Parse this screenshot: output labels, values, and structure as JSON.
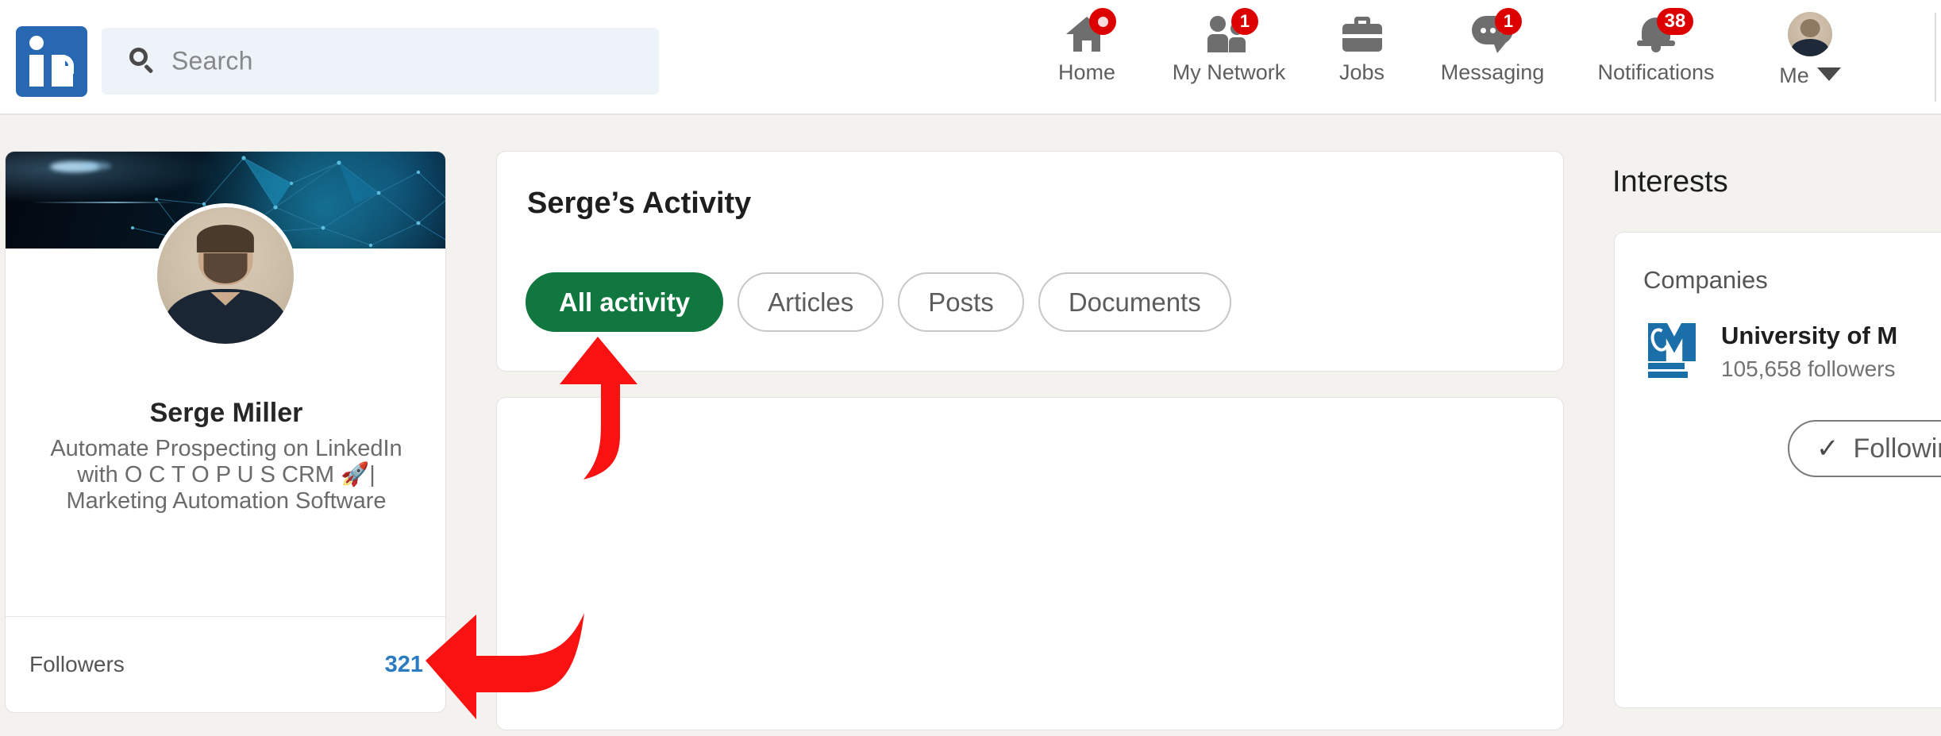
{
  "nav": {
    "logo_alt": "linkedin-logo",
    "search": {
      "placeholder": "Search",
      "value": ""
    },
    "items": [
      {
        "label": "Home",
        "icon": "home-icon",
        "badge": ""
      },
      {
        "label": "My Network",
        "icon": "network-icon",
        "badge": "1"
      },
      {
        "label": "Jobs",
        "icon": "briefcase-icon",
        "badge": ""
      },
      {
        "label": "Messaging",
        "icon": "message-icon",
        "badge": "1"
      },
      {
        "label": "Notifications",
        "icon": "bell-icon",
        "badge": "38"
      }
    ],
    "me": {
      "label": "Me",
      "caret": "chevron-down-icon"
    }
  },
  "profile": {
    "name": "Serge Miller",
    "headline": "Automate Prospecting on LinkedIn with O C T O P U S CRM 🚀| Marketing Automation Software",
    "followers_label": "Followers",
    "followers_count": "321"
  },
  "activity": {
    "title": "Serge’s Activity",
    "filters": [
      {
        "label": "All activity",
        "active": true
      },
      {
        "label": "Articles",
        "active": false
      },
      {
        "label": "Posts",
        "active": false
      },
      {
        "label": "Documents",
        "active": false
      }
    ]
  },
  "interests": {
    "title": "Interests",
    "section_label": "Companies",
    "company": {
      "name": "University of M",
      "followers": "105,658 followers",
      "logo": "umass-boston-logo",
      "follow_button": "Following",
      "follow_check": "✓"
    }
  },
  "annotations": [
    {
      "name": "arrow-pointing-to-all-activity",
      "color": "#F81212",
      "direction": "up"
    },
    {
      "name": "arrow-pointing-to-followers-count",
      "color": "#F81212",
      "direction": "left"
    }
  ],
  "colors": {
    "brand_blue": "#2867B2",
    "page_bg": "#F3F2EF",
    "active_pill_green": "#10783F",
    "link_blue": "#2A7BC2",
    "badge_red": "#DD0000",
    "annotation_red": "#F81212"
  }
}
